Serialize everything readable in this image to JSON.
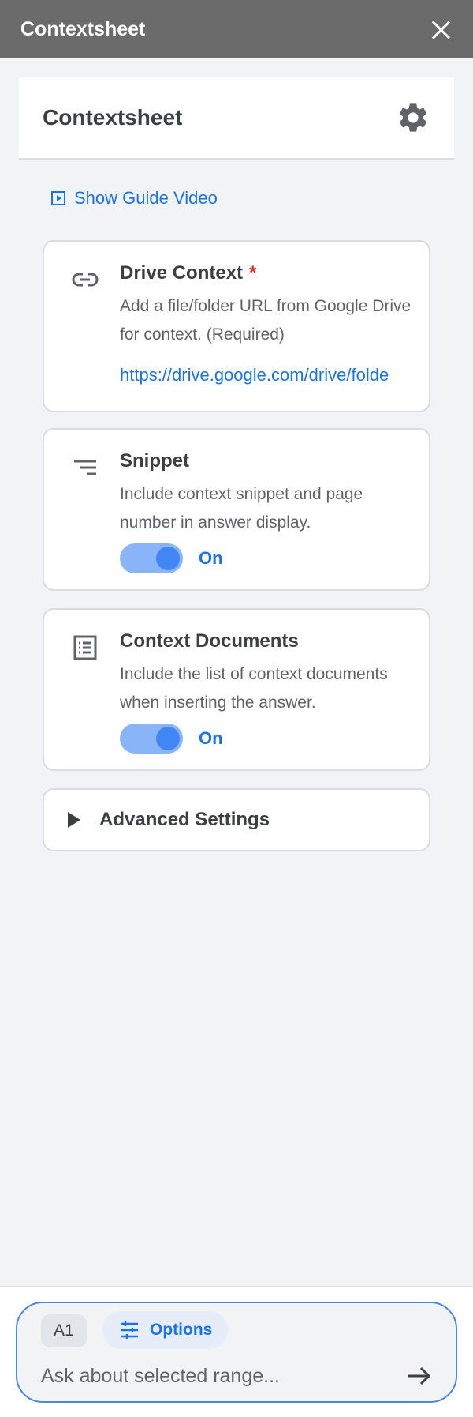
{
  "titlebar": {
    "title": "Contextsheet"
  },
  "header": {
    "title": "Contextsheet"
  },
  "guide": {
    "label": "Show Guide Video"
  },
  "drive_context": {
    "title": "Drive Context",
    "required_mark": "*",
    "description": "Add a file/folder URL from Google Drive for context. (Required)",
    "url": "https://drive.google.com/drive/folde"
  },
  "snippet": {
    "title": "Snippet",
    "description": "Include context snippet and page number in answer display.",
    "toggle_label": "On"
  },
  "context_documents": {
    "title": "Context Documents",
    "description": "Include the list of context documents when inserting the answer.",
    "toggle_label": "On"
  },
  "advanced": {
    "label": "Advanced Settings"
  },
  "composer": {
    "range_chip": "A1",
    "options_label": "Options",
    "placeholder": "Ask about selected range..."
  },
  "colors": {
    "accent": "#1a73e8",
    "required": "#d93025",
    "titlebar": "#6b6b6b"
  }
}
